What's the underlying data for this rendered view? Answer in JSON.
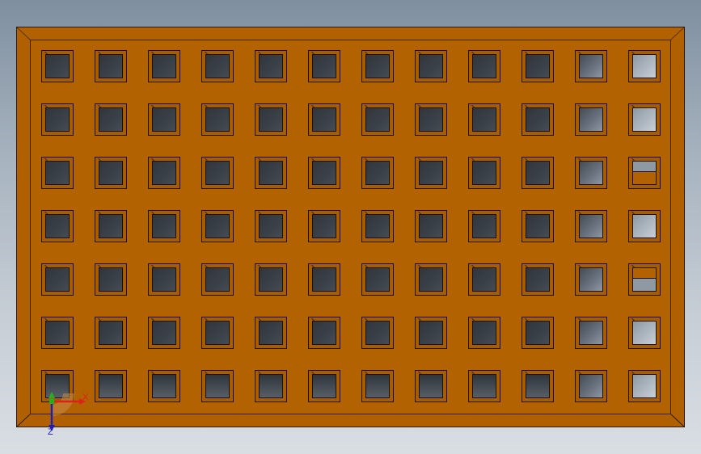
{
  "model": {
    "part_color": "#b36200",
    "edge_color": "#1b1006",
    "hole_grid": {
      "rows": 7,
      "columns": 12,
      "hole_types": [
        [
          "dark",
          "dark",
          "dark",
          "dark",
          "dark",
          "dark",
          "dark",
          "dark",
          "dark",
          "dark",
          "mid",
          "light"
        ],
        [
          "dark",
          "dark",
          "dark",
          "dark",
          "dark",
          "dark",
          "dark",
          "dark",
          "dark",
          "dark",
          "mid",
          "light"
        ],
        [
          "dark",
          "dark",
          "dark",
          "dark",
          "dark",
          "dark",
          "dark",
          "dark",
          "dark",
          "dark",
          "mid",
          "split"
        ],
        [
          "dark",
          "dark",
          "dark",
          "dark",
          "dark",
          "dark",
          "dark",
          "dark",
          "dark",
          "dark",
          "mid",
          "light"
        ],
        [
          "dark",
          "dark",
          "dark",
          "dark",
          "dark",
          "dark",
          "dark",
          "dark",
          "dark",
          "dark",
          "mid",
          "split2"
        ],
        [
          "dark",
          "dark",
          "dark",
          "dark",
          "dark",
          "dark",
          "dark",
          "dark",
          "dark",
          "dark",
          "mid",
          "light"
        ],
        [
          "dark",
          "dark",
          "dark",
          "dark",
          "dark",
          "dark",
          "dark",
          "dark",
          "dark",
          "dark",
          "mid",
          "light"
        ]
      ]
    }
  },
  "triad": {
    "x_label": "X",
    "z_label": "Z",
    "x_color": "#e0201a",
    "y_color": "#22b022",
    "z_color": "#2020b0"
  }
}
